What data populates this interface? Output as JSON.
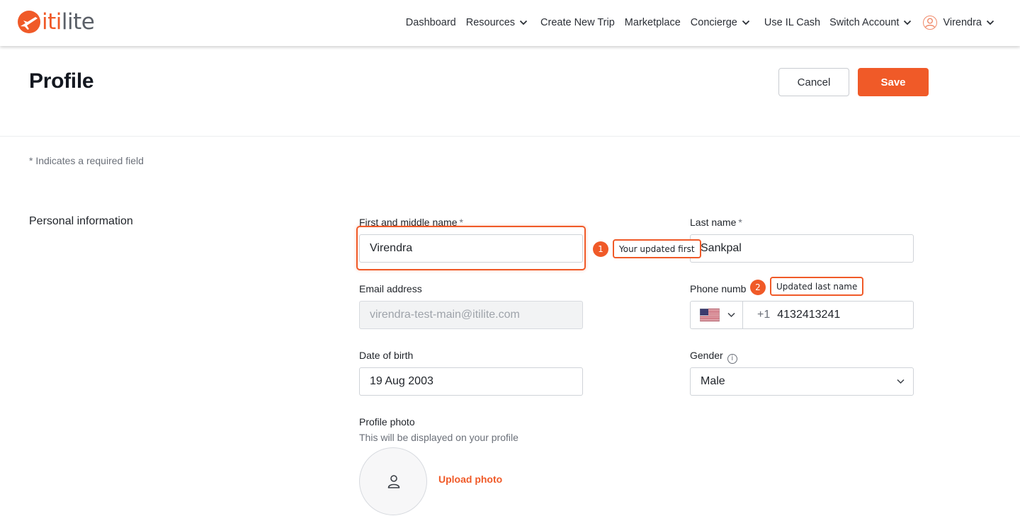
{
  "brand": {
    "logo_text_left": "iti",
    "logo_text_right": "lite",
    "accent_color": "#f05a28"
  },
  "nav": {
    "items": [
      {
        "label": "Dashboard",
        "dropdown": false
      },
      {
        "label": "Resources",
        "dropdown": true
      },
      {
        "label": "Create New Trip",
        "dropdown": false
      },
      {
        "label": "Marketplace",
        "dropdown": false
      },
      {
        "label": "Concierge",
        "dropdown": true
      },
      {
        "label": "Use IL Cash",
        "dropdown": false
      },
      {
        "label": "Switch Account",
        "dropdown": true
      }
    ],
    "user": {
      "name": "Virendra",
      "icon": "user-avatar-icon"
    }
  },
  "page": {
    "title": "Profile",
    "cancel_label": "Cancel",
    "save_label": "Save",
    "required_note": "* Indicates a required field"
  },
  "personal": {
    "section_title": "Personal information",
    "first_name": {
      "label": "First and middle name",
      "required": "*",
      "value": "Virendra"
    },
    "last_name": {
      "label": "Last name",
      "required": "*",
      "value": "Sankpal"
    },
    "email": {
      "label": "Email address",
      "value": "virendra-test-main@itilite.com",
      "disabled": true
    },
    "phone": {
      "label": "Phone numb",
      "country": "US",
      "country_icon": "us-flag-icon",
      "code": "+1",
      "value": "4132413241"
    },
    "dob": {
      "label": "Date of birth",
      "value": "19 Aug 2003"
    },
    "gender": {
      "label": "Gender",
      "value": "Male",
      "info_icon": "i"
    },
    "photo": {
      "label": "Profile photo",
      "hint": "This will be displayed on your profile",
      "upload_label": "Upload photo"
    }
  },
  "annotations": [
    {
      "number": "1",
      "text": "Your updated first"
    },
    {
      "number": "2",
      "text": "Updated last name"
    }
  ]
}
